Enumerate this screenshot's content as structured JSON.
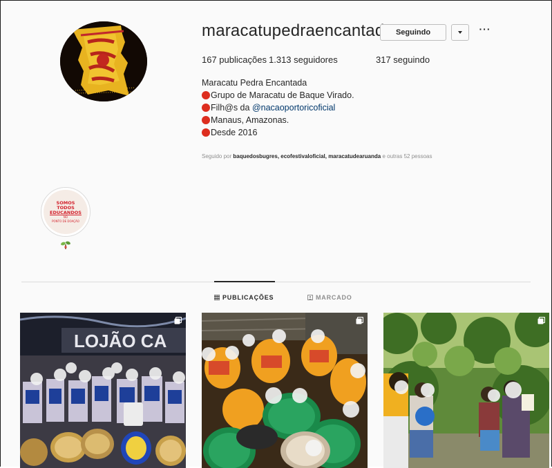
{
  "profile": {
    "username": "maracatupedraencantada",
    "follow_button": "Seguindo",
    "more_glyph": "···",
    "stats": {
      "posts": "167 publicações",
      "followers": "1.313 seguidores",
      "following": "317 seguindo"
    },
    "bio": {
      "name": "Maracatu Pedra Encantada",
      "line1": "Grupo de Maracatu de Baque Virado.",
      "line2_prefix": "Filh@s da ",
      "line2_mention": "@nacaoportoricoficial",
      "line3": "Manaus, Amazonas.",
      "line4": "Desde 2016"
    },
    "followed_by": {
      "prefix": "Seguido por ",
      "users": "baquedosbugres, ecofestivaloficial, maracatudearuanda",
      "suffix": " e outras 52 pessoas"
    }
  },
  "highlight": {
    "line1": "SOMOS",
    "line2": "TODOS",
    "line3": "EDUCANDOS",
    "line4": "NO",
    "line5": "PONTO DE DOAÇÃO",
    "label_icon": "plant-sprout-icon"
  },
  "tabs": {
    "posts": "PUBLICAÇÕES",
    "tagged": "MARCADO",
    "active": "posts"
  },
  "posts": [
    {
      "icon": "multi-photo-icon",
      "sign_text": "LOJÃO CA"
    },
    {
      "icon": "multi-photo-icon"
    },
    {
      "icon": "multi-photo-icon"
    }
  ],
  "colors": {
    "accent_red": "#dd2e1f",
    "mention_blue": "#00376b",
    "text": "#262626",
    "muted": "#8e8e8e"
  }
}
